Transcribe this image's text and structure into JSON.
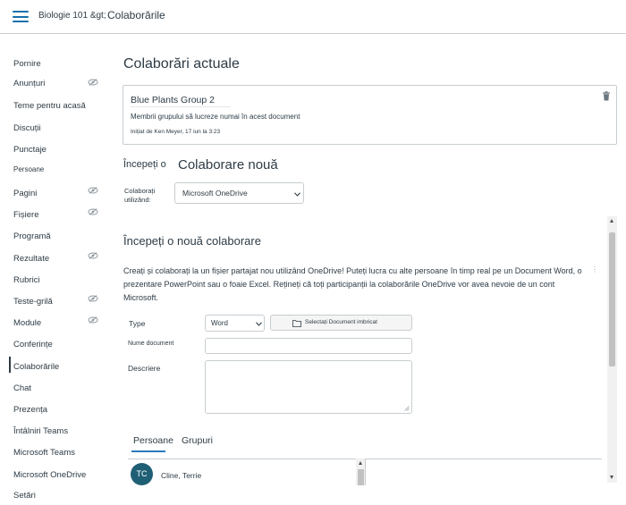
{
  "header": {
    "breadcrumb_course": "Biologie 101 &gt;",
    "breadcrumb_page": "Colaborările"
  },
  "sidebar": {
    "items": [
      {
        "label": "Pornire"
      },
      {
        "label": "Anunțuri"
      },
      {
        "label": "Teme pentru acasă"
      },
      {
        "label": "Discuții"
      },
      {
        "label": "Punctaje"
      },
      {
        "label": "Persoane"
      },
      {
        "label": "Pagini"
      },
      {
        "label": "Fișiere"
      },
      {
        "label": "Programă"
      },
      {
        "label": "Rezultate"
      },
      {
        "label": "Rubrici"
      },
      {
        "label": "Teste-grilă"
      },
      {
        "label": "Module"
      },
      {
        "label": "Conferințe"
      },
      {
        "label": "Colaborările"
      },
      {
        "label": "Chat"
      },
      {
        "label": "Prezența"
      },
      {
        "label": "Întâlniri Teams"
      },
      {
        "label": "Microsoft Teams"
      },
      {
        "label": "Microsoft OneDrive"
      },
      {
        "label": "Setări"
      }
    ],
    "active": "Colaborările"
  },
  "current": {
    "title": "Colaborări actuale",
    "card": {
      "name": "Blue Plants Group 2",
      "description": "Membrii grupului să lucreze numai în acest document",
      "meta": "Inițiat de Ken Meyer, 17 iun la 3:23"
    }
  },
  "new_collab": {
    "prefix": "Începeți o",
    "title": "Colaborare nouă",
    "collab_with_label": "Colaborați utilizând:",
    "service_value": "Microsoft OneDrive"
  },
  "form": {
    "section_title": "Începeți o nouă colaborare",
    "description": "Creați și colaborați la un fișier partajat nou utilizând OneDrive! Puteți lucra cu alte persoane în timp real pe un Document Word, o prezentare PowerPoint sau o foaie Excel. Rețineți că toți participanții la colaborările OneDrive vor avea nevoie de un cont Microsoft.",
    "type_label": "Type",
    "type_value": "Word",
    "embed_button": "Selectați Document imbricat",
    "name_label": "Nume document",
    "desc_label": "Descriere",
    "tabs": [
      "Persoane",
      "Grupuri"
    ],
    "people": [
      {
        "initials": "TC",
        "name": "Cline, Terrie"
      }
    ]
  },
  "colors": {
    "accent": "#1770ab",
    "avatar": "#1f5f75",
    "tab_underline": "#2b7abc"
  }
}
